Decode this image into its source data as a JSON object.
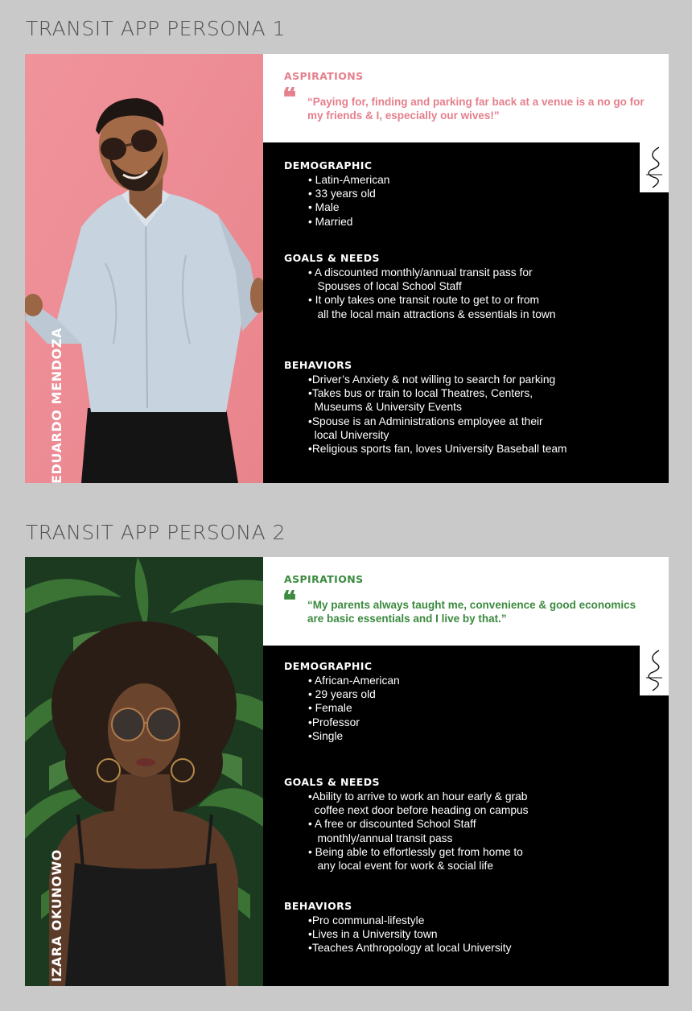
{
  "persona1": {
    "frame_title": "TRANSIT APP PERSONA 1",
    "name": "EDUARDO MENDOZA",
    "accent": "#e57f8c",
    "aspirations_title": "ASPIRATIONS",
    "quote": "“Paying for, finding and parking far back at a venue is a no go for my friends & I, especially our wives!”",
    "sections": [
      {
        "title": "DEMOGRAPHIC",
        "items": [
          "• Latin-American",
          "• 33 years old",
          "• Male",
          "• Married"
        ]
      },
      {
        "title": "GOALS & NEEDS",
        "items": [
          "• A discounted monthly/annual transit pass for",
          "   Spouses of local School Staff",
          "• It only takes one transit route to get to or from",
          "   all the local main attractions & essentials in town"
        ]
      },
      {
        "title": "BEHAVIORS",
        "items": [
          "•Driver’s Anxiety & not willing to search for parking",
          "•Takes bus or train to local Theatres, Centers,",
          "  Museums & University Events",
          "•Spouse is an Administrations employee at their",
          "  local University",
          "•Religious sports fan, loves University Baseball team"
        ]
      }
    ]
  },
  "persona2": {
    "frame_title": "TRANSIT APP PERSONA 2",
    "name": "IZARA OKUNOWO",
    "accent": "#3b8a3e",
    "aspirations_title": "ASPIRATIONS",
    "quote": "“My parents always taught me, convenience & good economics are basic essentials and I live by that.”",
    "sections": [
      {
        "title": "DEMOGRAPHIC",
        "items": [
          "• African-American",
          "• 29 years old",
          "• Female",
          "•Professor",
          "•Single"
        ]
      },
      {
        "title": "GOALS & NEEDS",
        "items": [
          "•Ability to arrive to work an hour early & grab",
          "  coffee next door before heading on campus",
          "• A free or discounted School Staff",
          "   monthly/annual transit pass",
          "• Being able to effortlessly get from home to",
          "   any local event for work & social life"
        ]
      },
      {
        "title": "BEHAVIORS",
        "items": [
          "•Pro communal-lifestyle",
          "•Lives in a University town",
          "•Teaches Anthropology at local University"
        ]
      }
    ]
  }
}
